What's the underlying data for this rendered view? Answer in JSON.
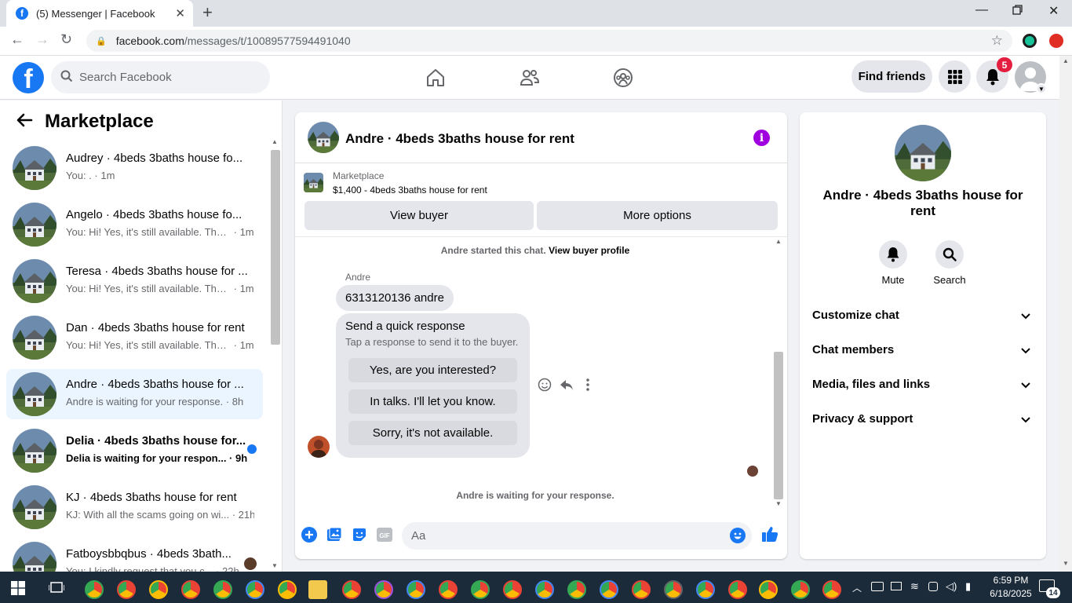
{
  "browser": {
    "tab_title": "(5) Messenger | Facebook",
    "url_domain": "facebook.com",
    "url_path": "/messages/t/10089577594491040"
  },
  "header": {
    "search_placeholder": "Search Facebook",
    "find_friends": "Find friends",
    "notification_count": "5"
  },
  "sidebar": {
    "title": "Marketplace",
    "conversations": [
      {
        "name": "Audrey · 4beds 3baths house fo...",
        "preview": "You: .",
        "time": "1m"
      },
      {
        "name": "Angelo · 4beds 3baths house fo...",
        "preview": "You: Hi! Yes, it's still available. Than...",
        "time": "1m"
      },
      {
        "name": "Teresa · 4beds 3baths house for ...",
        "preview": "You: Hi! Yes, it's still available. Than...",
        "time": "1m"
      },
      {
        "name": "Dan · 4beds 3baths house for rent",
        "preview": "You: Hi! Yes, it's still available. Than...",
        "time": "1m"
      },
      {
        "name": "Andre · 4beds 3baths house for ...",
        "preview": "Andre is waiting for your response.",
        "time": "8h"
      },
      {
        "name": "Delia · 4beds 3baths house for...",
        "preview": "Delia is waiting for your respon...",
        "time": "9h"
      },
      {
        "name": "KJ · 4beds 3baths house for rent",
        "preview": "KJ: With all the scams going on wi...",
        "time": "21h"
      },
      {
        "name": "Fatboysbbqbus · 4beds 3bath...",
        "preview": "You: I kindly request that you c...",
        "time": "22h"
      }
    ]
  },
  "chat": {
    "title": "Andre · 4beds 3baths house for rent",
    "marketplace_label": "Marketplace",
    "listing": "$1,400 - 4beds 3baths house for rent",
    "view_buyer": "View buyer",
    "more_options": "More options",
    "started_text": "Andre started this chat.",
    "view_buyer_profile": "View buyer profile",
    "sender": "Andre",
    "message": "6313120136 andre",
    "quick_title": "Send a quick response",
    "quick_sub": "Tap a response to send it to the buyer.",
    "quick_replies": [
      "Yes, are you interested?",
      "In talks. I'll let you know.",
      "Sorry, it's not available."
    ],
    "waiting_text": "Andre is waiting for your response.",
    "composer_placeholder": "Aa"
  },
  "info": {
    "name": "Andre · 4beds 3baths house for rent",
    "mute": "Mute",
    "search": "Search",
    "sections": [
      "Customize chat",
      "Chat members",
      "Media, files and links",
      "Privacy & support"
    ]
  },
  "taskbar": {
    "time": "6:59 PM",
    "date": "6/18/2025",
    "notifications": "14"
  },
  "colors": {
    "brand": "#1877f2",
    "active_conversation": "#ebf5ff",
    "info_icon": "#a000e0",
    "badge": "#e41e3f"
  }
}
